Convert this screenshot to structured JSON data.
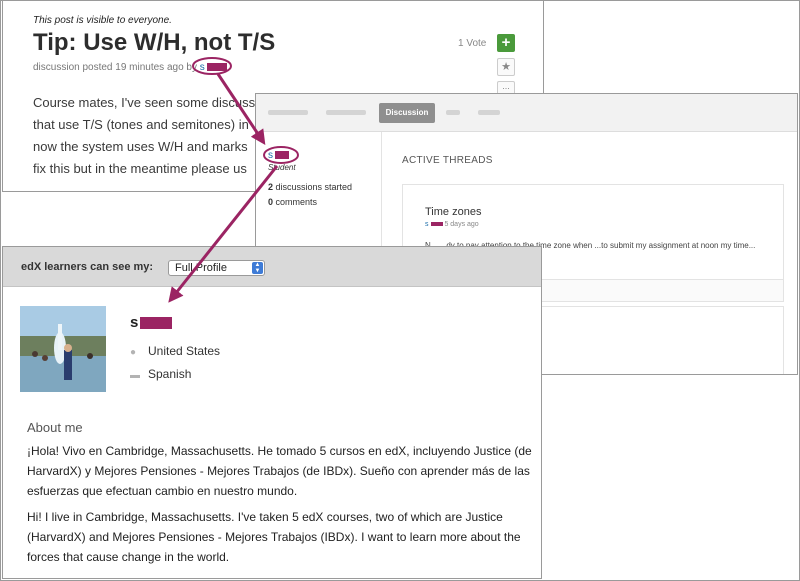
{
  "post": {
    "visibility": "This post is visible to everyone.",
    "title": "Tip: Use W/H, not T/S",
    "meta": "discussion posted 19 minutes ago by",
    "author_initial": "s",
    "vote_count": "1 Vote",
    "vote_icon": "+",
    "star_icon": "★",
    "more_icon": "...",
    "body_lines": [
      "Course mates, I've seen some discuss",
      "that use T/S (tones and semitones) in",
      "now the system uses W/H and marks",
      "fix this but in the meantime please us"
    ]
  },
  "discussion": {
    "active_tab": "Discussion",
    "user_initial": "s",
    "role": "Student",
    "discussions_count": "2",
    "discussions_label": "discussions started",
    "comments_count": "0",
    "comments_label": "comments",
    "heading": "ACTIVE THREADS",
    "thread": {
      "title": "Time zones",
      "meta_initial": "s",
      "meta_time": "5 days ago",
      "body": "N...        ...dy to pay attention to the time zone when ...to submit my assignment at noon my time..."
    }
  },
  "profile": {
    "visibility_label": "edX learners can see my:",
    "visibility_value": "Full Profile",
    "name_initial": "s",
    "location": "United States",
    "language": "Spanish",
    "about_heading": "About me",
    "about_es": "¡Hola! Vivo en Cambridge, Massachusetts. He tomado 5 cursos en edX, incluyendo Justice (de HarvardX) y Mejores Pensiones - Mejores Trabajos (de IBDx). Sueño con aprender más de las esfuerzas que efectuan cambio en nuestro mundo.",
    "about_en": "Hi! I live in Cambridge, Massachusetts. I've taken 5 edX courses, two of which are Justice (HarvardX) and Mejores Pensiones - Mejores Trabajos (IBDx). I want to learn more about the forces that cause change in the world."
  },
  "colors": {
    "annotation": "#9b2463",
    "vote_green": "#4a9a3b",
    "link_blue": "#1b6ca8"
  },
  "icons": {
    "location": "map-pin-icon",
    "language": "speech-bubble-icon"
  }
}
